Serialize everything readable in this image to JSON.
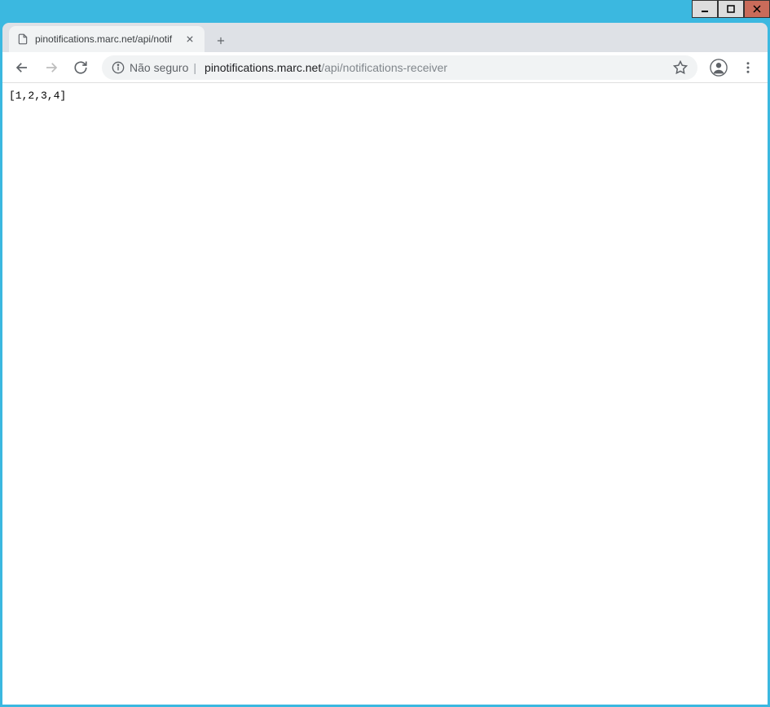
{
  "window": {
    "tab_title": "pinotifications.marc.net/api/notif"
  },
  "address_bar": {
    "security_label": "Não seguro",
    "url_host": "pinotifications.marc.net",
    "url_path": "/api/notifications-receiver"
  },
  "page_body": {
    "content": "[1,2,3,4]"
  }
}
